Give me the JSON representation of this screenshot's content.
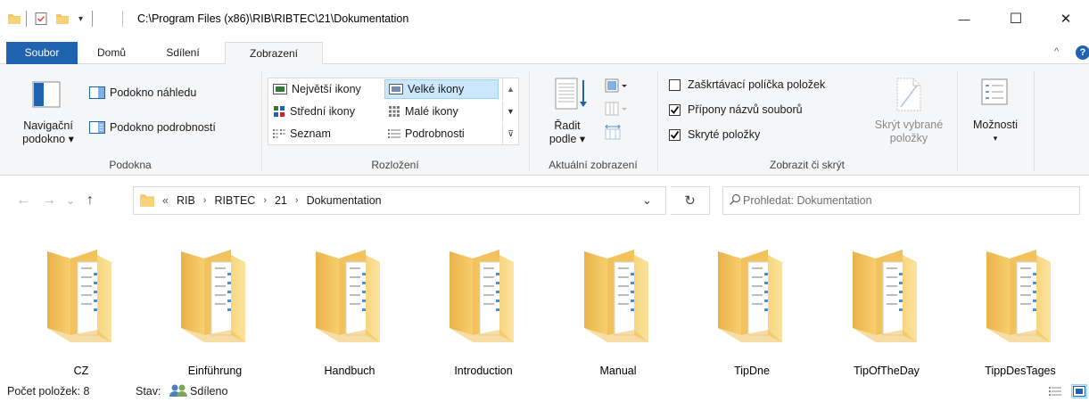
{
  "window": {
    "title_path": "C:\\Program Files (x86)\\RIB\\RIBTEC\\21\\Dokumentation",
    "minimize_glyph": "—",
    "maximize_glyph": "☐",
    "close_glyph": "✕"
  },
  "tabs": [
    {
      "label": "Soubor"
    },
    {
      "label": "Domů"
    },
    {
      "label": "Sdílení"
    },
    {
      "label": "Zobrazení"
    }
  ],
  "ribbon": {
    "collapse_glyph": "^",
    "help_glyph": "?",
    "panes": {
      "label": "Podokna",
      "nav_pane": "Navigační",
      "nav_pane_line2": "podokno ▾",
      "preview_pane": "Podokno náhledu",
      "details_pane": "Podokno podrobností"
    },
    "layout": {
      "label": "Rozložení",
      "items": [
        {
          "label": "Největší ikony"
        },
        {
          "label": "Velké ikony"
        },
        {
          "label": "Střední ikony"
        },
        {
          "label": "Malé ikony"
        },
        {
          "label": "Seznam"
        },
        {
          "label": "Podrobnosti"
        }
      ]
    },
    "current_view": {
      "label": "Aktuální zobrazení",
      "sort": "Řadit",
      "sort_line2": "podle ▾"
    },
    "show_hide": {
      "label": "Zobrazit či skrýt",
      "checkboxes": [
        {
          "label": "Zaškrtávací políčka položek",
          "checked": false
        },
        {
          "label": "Přípony názvů souborů",
          "checked": true
        },
        {
          "label": "Skryté položky",
          "checked": true
        }
      ],
      "hide_selected": "Skrýt vybrané",
      "hide_selected_line2": "položky"
    },
    "options": {
      "label": "Možnosti",
      "arrow": "▾"
    }
  },
  "address": {
    "overflow": "«",
    "crumbs": [
      "RIB",
      "RIBTEC",
      "21",
      "Dokumentation"
    ],
    "separator": "›",
    "dropdown_glyph": "⌄",
    "refresh_glyph": "↻",
    "search_placeholder": "Prohledat: Dokumentation"
  },
  "nav": {
    "back": "←",
    "forward": "→",
    "recent": "⌄",
    "up": "↑"
  },
  "folders": [
    {
      "name": "CZ"
    },
    {
      "name": "Einführung"
    },
    {
      "name": "Handbuch"
    },
    {
      "name": "Introduction"
    },
    {
      "name": "Manual"
    },
    {
      "name": "TipDne"
    },
    {
      "name": "TipOfTheDay"
    },
    {
      "name": "TippDesTages"
    }
  ],
  "status": {
    "count": "Počet položek: 8",
    "state_label": "Stav:",
    "state_value": "Sdíleno"
  },
  "colors": {
    "accent": "#1e62b0",
    "folder": "#f6c65b",
    "folder_dark": "#e2a63a",
    "selection": "#cce8ff"
  }
}
